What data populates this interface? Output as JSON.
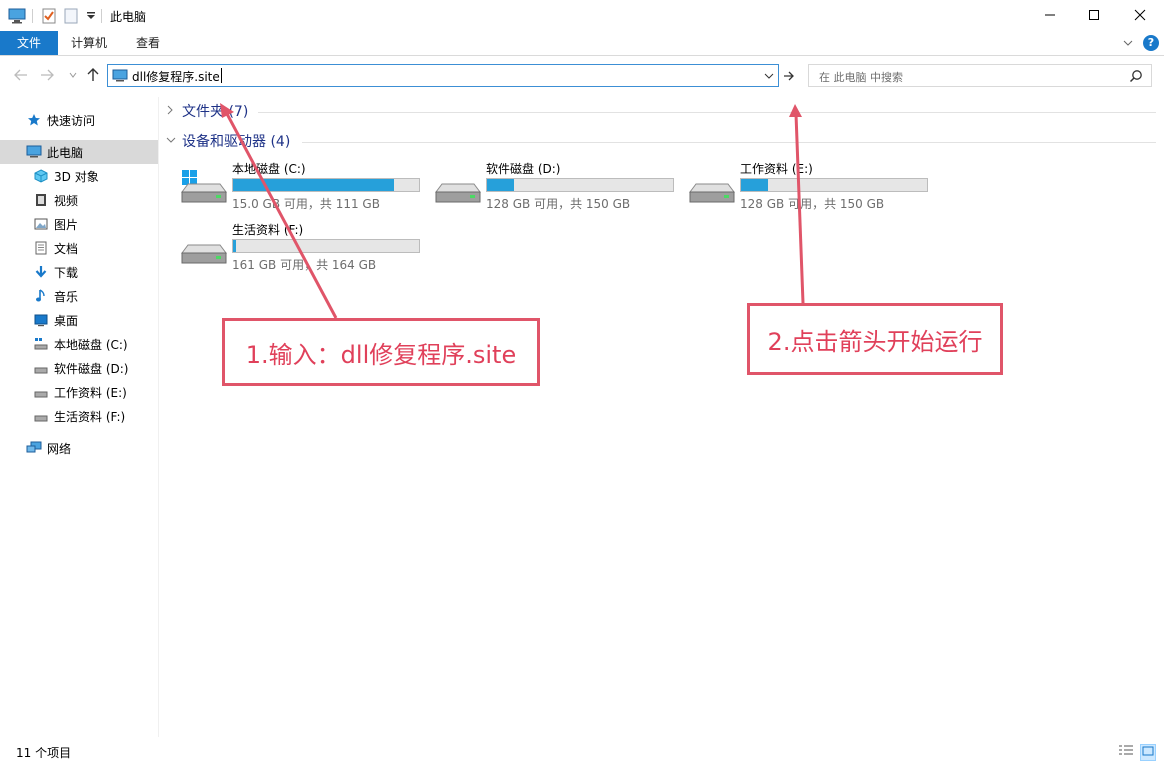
{
  "window": {
    "title": "此电脑",
    "controls": {
      "minimize_icon": "minimize-icon",
      "maximize_icon": "maximize-icon",
      "close_icon": "close-icon"
    }
  },
  "ribbon": {
    "tabs": [
      {
        "label": "文件",
        "active": true
      },
      {
        "label": "计算机",
        "active": false
      },
      {
        "label": "查看",
        "active": false
      }
    ],
    "help_label": "?"
  },
  "address": {
    "value": "dll修复程序.site",
    "search_placeholder": "在 此电脑 中搜索"
  },
  "sidebar": {
    "items": [
      {
        "label": "快速访问",
        "icon": "star-icon"
      },
      {
        "label": "此电脑",
        "icon": "pc-icon",
        "selected": true
      },
      {
        "label": "3D 对象",
        "icon": "cube-icon"
      },
      {
        "label": "视频",
        "icon": "video-icon"
      },
      {
        "label": "图片",
        "icon": "picture-icon"
      },
      {
        "label": "文档",
        "icon": "document-icon"
      },
      {
        "label": "下载",
        "icon": "download-icon"
      },
      {
        "label": "音乐",
        "icon": "music-icon"
      },
      {
        "label": "桌面",
        "icon": "desktop-icon"
      },
      {
        "label": "本地磁盘 (C:)",
        "icon": "drive-icon"
      },
      {
        "label": "软件磁盘 (D:)",
        "icon": "drive-icon"
      },
      {
        "label": "工作资料 (E:)",
        "icon": "drive-icon"
      },
      {
        "label": "生活资料 (F:)",
        "icon": "drive-icon"
      },
      {
        "label": "网络",
        "icon": "network-icon"
      }
    ]
  },
  "content": {
    "groups": [
      {
        "label": "文件夹 (7)",
        "expanded": false
      },
      {
        "label": "设备和驱动器 (4)",
        "expanded": true
      }
    ],
    "drives": [
      {
        "name": "本地磁盘 (C:)",
        "info": "15.0 GB 可用，共 111 GB",
        "used_fraction": 0.865,
        "system": true
      },
      {
        "name": "软件磁盘 (D:)",
        "info": "128 GB 可用，共 150 GB",
        "used_fraction": 0.147,
        "system": false
      },
      {
        "name": "工作资料 (E:)",
        "info": "128 GB 可用，共 150 GB",
        "used_fraction": 0.147,
        "system": false
      },
      {
        "name": "生活资料 (F:)",
        "info": "161 GB 可用，共 164 GB",
        "used_fraction": 0.018,
        "system": false
      }
    ],
    "bar_color": "#26a0da"
  },
  "status": {
    "count": "11 个项目"
  },
  "annotations": {
    "step1": "1.输入：dll修复程序.site",
    "step2": "2.点击箭头开始运行",
    "color": "#e05569"
  }
}
